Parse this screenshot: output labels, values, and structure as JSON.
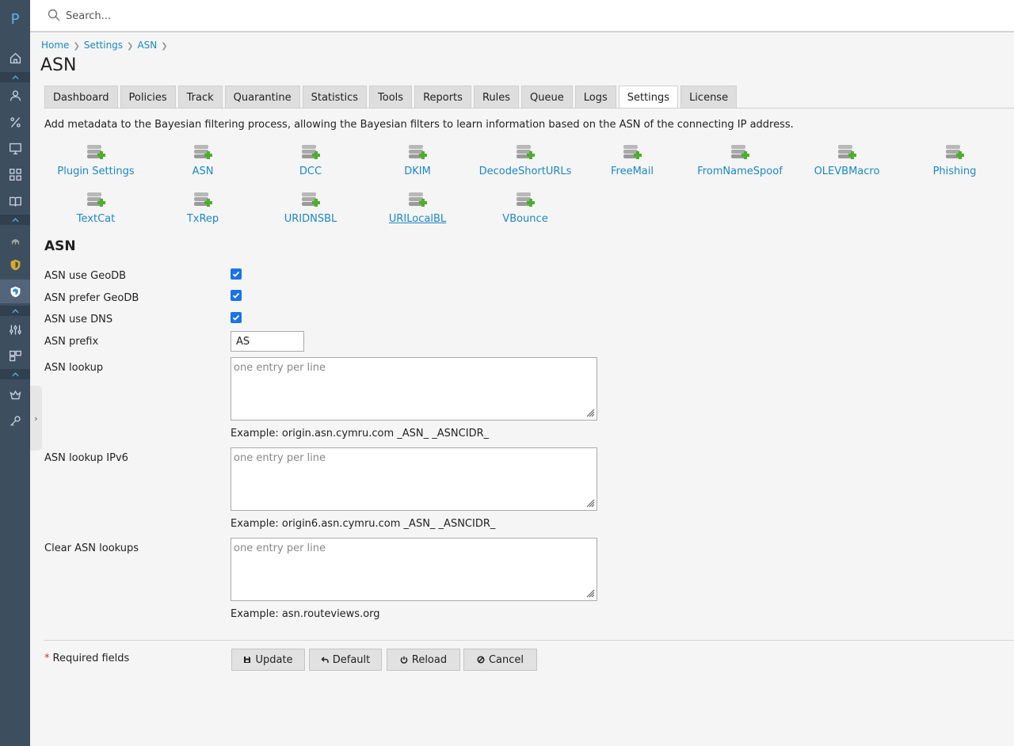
{
  "app": {
    "logo": "P"
  },
  "search": {
    "placeholder": "Search..."
  },
  "breadcrumb": [
    "Home",
    "Settings",
    "ASN"
  ],
  "page_title": "ASN",
  "tabs": [
    "Dashboard",
    "Policies",
    "Track",
    "Quarantine",
    "Statistics",
    "Tools",
    "Reports",
    "Rules",
    "Queue",
    "Logs",
    "Settings",
    "License"
  ],
  "active_tab": "Settings",
  "description": "Add metadata to the Bayesian filtering process, allowing the Bayesian filters to learn information based on the ASN of the connecting IP address.",
  "plugins": [
    "Plugin Settings",
    "ASN",
    "DCC",
    "DKIM",
    "DecodeShortURLs",
    "FreeMail",
    "FromNameSpoof",
    "OLEVBMacro",
    "Phishing",
    "TextCat",
    "TxRep",
    "URIDNSBL",
    "URILocalBL",
    "VBounce"
  ],
  "form": {
    "section_title": "ASN",
    "use_geodb": {
      "label": "ASN use GeoDB",
      "checked": true
    },
    "prefer_geodb": {
      "label": "ASN prefer GeoDB",
      "checked": true
    },
    "use_dns": {
      "label": "ASN use DNS",
      "checked": true
    },
    "prefix": {
      "label": "ASN prefix",
      "value": "AS"
    },
    "lookup": {
      "label": "ASN lookup",
      "placeholder": "one entry per line",
      "example": "Example: origin.asn.cymru.com _ASN_ _ASNCIDR_"
    },
    "lookup_ipv6": {
      "label": "ASN lookup IPv6",
      "placeholder": "one entry per line",
      "example": "Example: origin6.asn.cymru.com _ASN_ _ASNCIDR_"
    },
    "clear_lookups": {
      "label": "Clear ASN lookups",
      "placeholder": "one entry per line",
      "example": "Example: asn.routeviews.org"
    }
  },
  "required": {
    "star": "*",
    "text": "Required fields"
  },
  "buttons": {
    "update": "Update",
    "default": "Default",
    "reload": "Reload",
    "cancel": "Cancel"
  },
  "colors": {
    "sidebar": "#3d4e5f",
    "link": "#1e88c3",
    "checkbox": "#1a73e8",
    "plugin_icon_green": "#4caf2a"
  }
}
